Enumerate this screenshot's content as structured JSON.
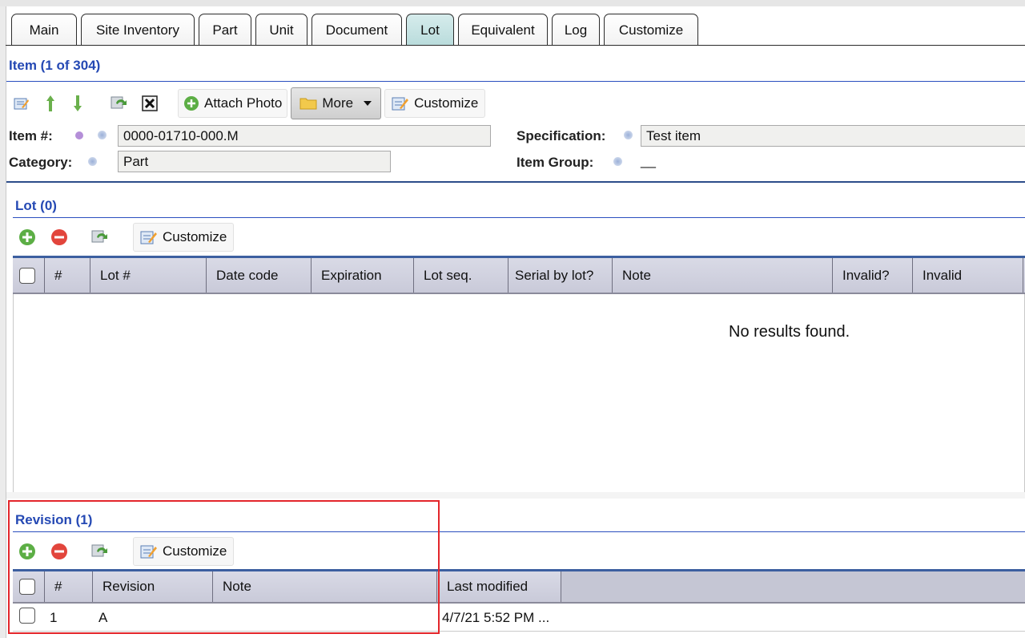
{
  "tabs": [
    {
      "label": "Main",
      "active": false
    },
    {
      "label": "Site Inventory",
      "active": false
    },
    {
      "label": "Part",
      "active": false
    },
    {
      "label": "Unit",
      "active": false
    },
    {
      "label": "Document",
      "active": false
    },
    {
      "label": "Lot",
      "active": true
    },
    {
      "label": "Equivalent",
      "active": false
    },
    {
      "label": "Log",
      "active": false
    },
    {
      "label": "Customize",
      "active": false
    }
  ],
  "item": {
    "title": "Item (1 of 304)",
    "toolbar": {
      "attach_photo_label": "Attach Photo",
      "more_label": "More",
      "customize_label": "Customize"
    },
    "fields": {
      "item_no_label": "Item #:",
      "item_no_value": "0000-01710-000.M",
      "category_label": "Category:",
      "category_value": "Part",
      "specification_label": "Specification:",
      "specification_value": "Test item",
      "item_group_label": "Item Group:",
      "item_group_value": "__"
    }
  },
  "lot": {
    "title": "Lot (0)",
    "customize_label": "Customize",
    "columns": [
      "#",
      "Lot #",
      "Date code",
      "Expiration",
      "Lot seq.",
      "Serial by lot?",
      "Note",
      "Invalid?",
      "Invalid"
    ],
    "empty_message": "No results found."
  },
  "revision": {
    "title": "Revision (1)",
    "customize_label": "Customize",
    "columns": [
      "#",
      "Revision",
      "Note",
      "Last modified"
    ],
    "rows": [
      {
        "num": "1",
        "revision": "A",
        "note": "",
        "last_modified": "4/7/21 5:52 PM ..."
      }
    ]
  },
  "colors": {
    "accent": "#2549b4",
    "active_tab": "#b9dcdc",
    "highlight": "#e3262b"
  }
}
